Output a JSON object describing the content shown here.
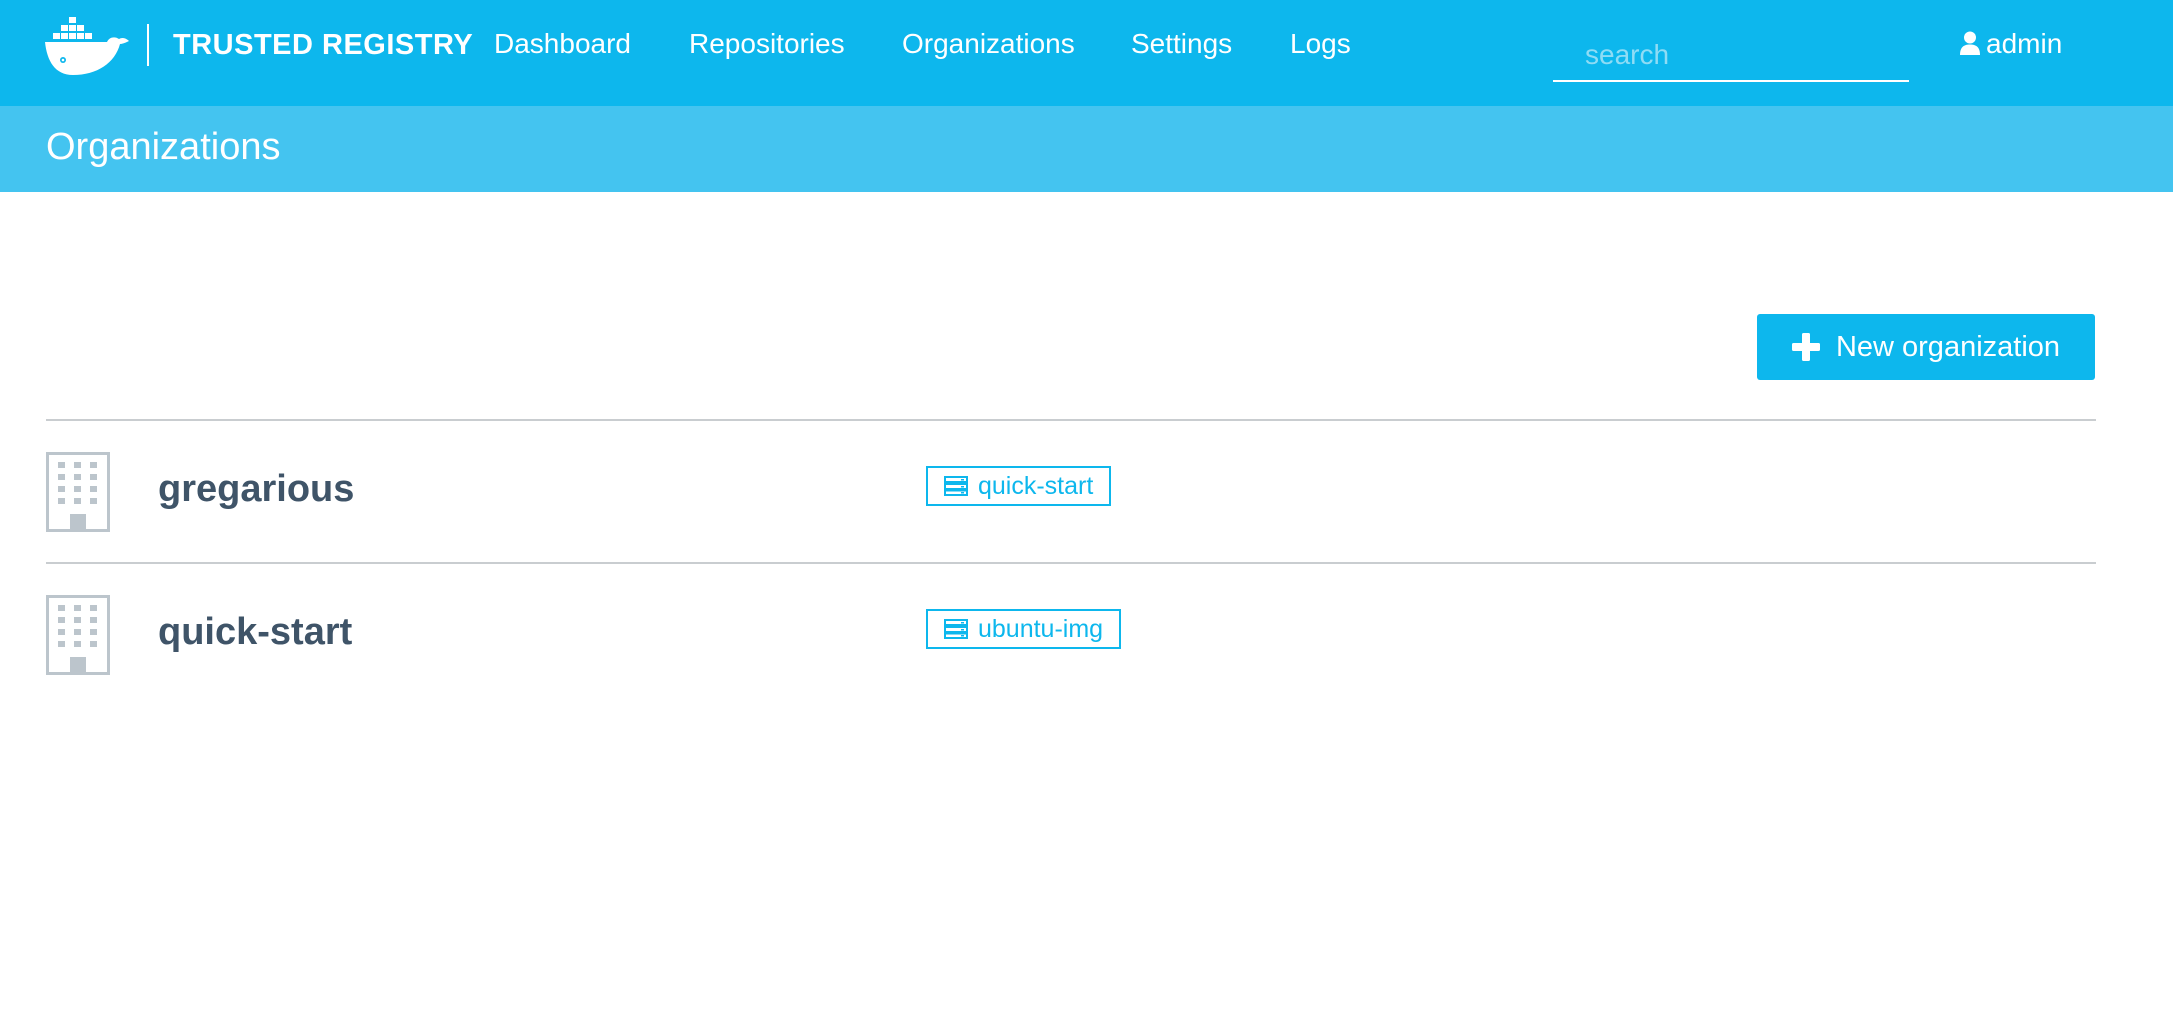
{
  "header": {
    "brand": "TRUSTED REGISTRY",
    "nav": [
      "Dashboard",
      "Repositories",
      "Organizations",
      "Settings",
      "Logs"
    ],
    "search_placeholder": "search",
    "user": "admin"
  },
  "page": {
    "title": "Organizations",
    "new_button_label": "New organization"
  },
  "organizations": [
    {
      "name": "gregarious",
      "repo": "quick-start"
    },
    {
      "name": "quick-start",
      "repo": "ubuntu-img"
    }
  ],
  "colors": {
    "accent": "#0db7ed",
    "subheader": "#44c4f0",
    "org_name": "#3f5468",
    "icon_gray": "#bcc5cc",
    "divider": "#c9cdd0"
  }
}
